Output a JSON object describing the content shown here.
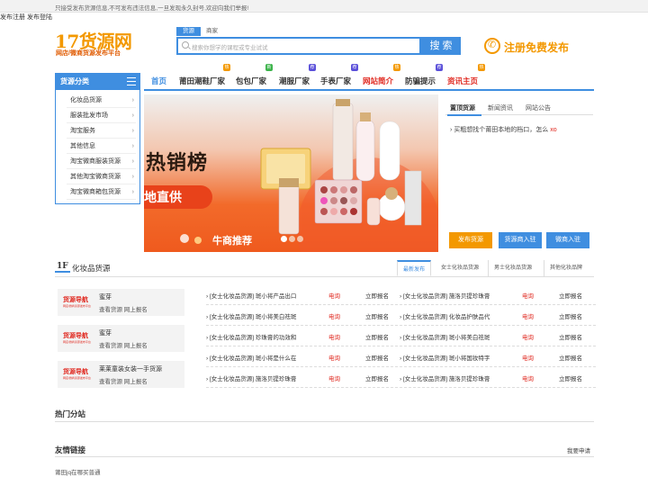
{
  "topbar": {
    "notice": "只接受发布货源信息,不可发布违法信息,一旦发现永久封号,欢迎向我们举报!",
    "links": [
      "发布注册",
      "发布登陆"
    ]
  },
  "logo": {
    "main_num": "17",
    "main_text": "货源网",
    "subtitle": "网店/微商货源发布平台"
  },
  "search": {
    "tabs": [
      "货源",
      "商家"
    ],
    "active_tab": 0,
    "placeholder": "搜索你想学的课程或专业试试",
    "button": "搜 索"
  },
  "register": {
    "label": "注册免费发布"
  },
  "category_header": "货源分类",
  "categories": [
    "化妆品货源",
    "服装批发市场",
    "淘宝服务",
    "其他信息",
    "淘宝微商服装货源",
    "其他淘宝微商货源",
    "淘宝微商箱包货源"
  ],
  "nav": [
    {
      "label": "首页",
      "badge": "",
      "badge_color": ""
    },
    {
      "label": "莆田潮鞋厂家",
      "badge": "热",
      "badge_color": "#f39800"
    },
    {
      "label": "包包厂家",
      "badge": "新",
      "badge_color": "#3bb34a"
    },
    {
      "label": "潮服厂家",
      "badge": "荐",
      "badge_color": "#5a4fd9"
    },
    {
      "label": "手表厂家",
      "badge": "荐",
      "badge_color": "#5a4fd9"
    },
    {
      "label": "网站简介",
      "badge": "热",
      "badge_color": "#f39800"
    },
    {
      "label": "防骗提示",
      "badge": "荐",
      "badge_color": "#5a4fd9"
    },
    {
      "label": "资讯主页",
      "badge": "热",
      "badge_color": "#f39800"
    }
  ],
  "banner": {
    "hot_text": "热销榜",
    "live_text": "地直供",
    "rec_text": "牛商推荐",
    "slides": 3,
    "active_slide": 0
  },
  "notice_panel": {
    "tabs": [
      "置顶货源",
      "新闻资讯",
      "网站公告"
    ],
    "link_text": "买粗想找个莆田本地的档口，怎么",
    "link_red": "xo",
    "buttons": [
      {
        "label": "发布货源",
        "color": "#f39800"
      },
      {
        "label": "货源商入驻",
        "color": "#3f8ee0"
      },
      {
        "label": "微商入驻",
        "color": "#3f8ee0"
      }
    ]
  },
  "floor1": {
    "num": "1F",
    "title": "化妆品货源",
    "tabs": [
      "最新发布",
      "女士化妆品货源",
      "男士化妆品货源",
      "其他化妆品牌"
    ],
    "active_tab": 0,
    "cards": [
      {
        "logo_title": "货源导航",
        "logo_sub": "网店/微商货源发布平台",
        "name": "蜜芽",
        "link": "查看货源 网上报名"
      },
      {
        "logo_title": "货源导航",
        "logo_sub": "网店/微商货源发布平台",
        "name": "蜜芽",
        "link": "查看货源 网上报名"
      },
      {
        "logo_title": "货源导航",
        "logo_sub": "网店/微商货源发布平台",
        "name": "莱莱童装女装一手货源",
        "link": "查看货源 网上报名"
      }
    ],
    "rows_left": [
      {
        "text": "[女士化妆品货源] 斑小将产品出口",
        "tel": "电询",
        "sign": "立即报名"
      },
      {
        "text": "[女士化妆品货源] 斑小将美白祛斑",
        "tel": "电询",
        "sign": "立即报名"
      },
      {
        "text": "[女士化妆品货源] 珍珠膏的功效和",
        "tel": "电询",
        "sign": "立即报名"
      },
      {
        "text": "[女士化妆品货源] 斑小将是什么在",
        "tel": "电询",
        "sign": "立即报名"
      },
      {
        "text": "[女士化妆品货源] 施洛贝提珍珠膏",
        "tel": "电询",
        "sign": "立即报名"
      }
    ],
    "rows_right": [
      {
        "text": "[女士化妆品货源] 施洛贝提珍珠膏",
        "tel": "电询",
        "sign": "立即报名"
      },
      {
        "text": "[女士化妆品货源] 化妆品护肤品代",
        "tel": "电询",
        "sign": "立即报名"
      },
      {
        "text": "[女士化妆品货源] 斑小将美白祛斑",
        "tel": "电询",
        "sign": "立即报名"
      },
      {
        "text": "[女士化妆品货源] 斑小将国妆特字",
        "tel": "电询",
        "sign": "立即报名"
      },
      {
        "text": "[女士化妆品货源] 施洛贝提珍珠膏",
        "tel": "电询",
        "sign": "立即报名"
      }
    ]
  },
  "hot_branches": {
    "title": "热门分站"
  },
  "friend_links": {
    "title": "友情链接",
    "apply": "我要申请",
    "items": [
      "莆田jq在哪买普通"
    ]
  }
}
